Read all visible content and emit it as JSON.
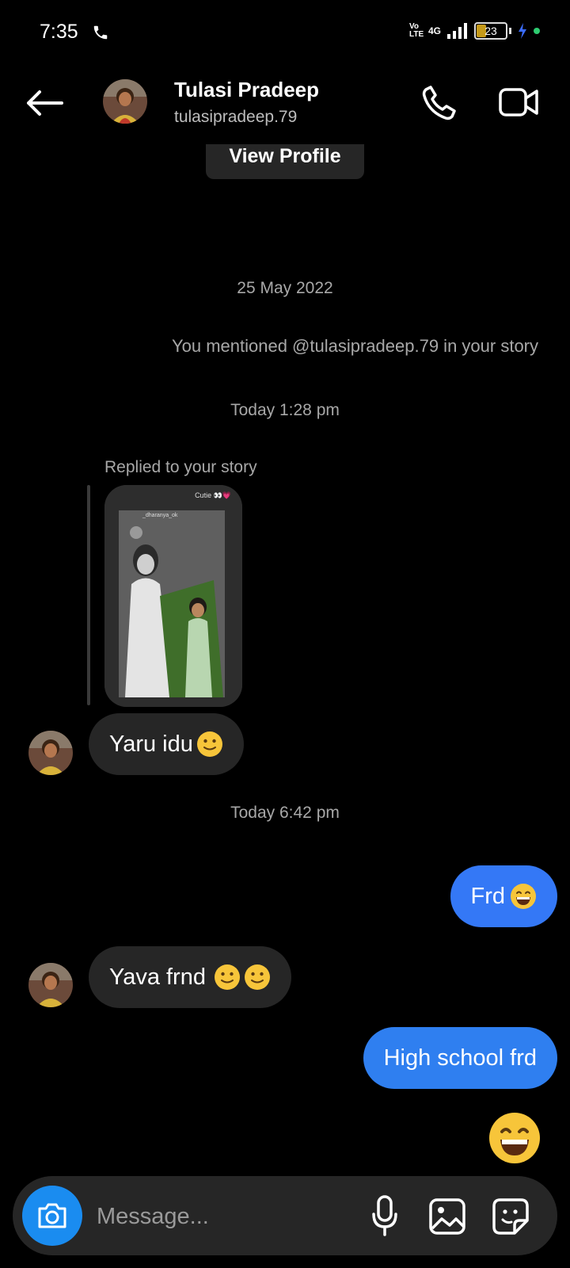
{
  "status_bar": {
    "time": "7:35",
    "volte": "Vo LTE",
    "network": "4G",
    "battery": "23"
  },
  "header": {
    "name": "Tulasi Pradeep",
    "handle": "tulasipradeep.79",
    "view_profile": "View Profile"
  },
  "thread": {
    "date_1": "25 May 2022",
    "mention_note": "You mentioned @tulasipradeep.79 in your story",
    "time_1": "Today 1:28 pm",
    "story_reply_label": "Replied to your story",
    "story_caption": "Cutie 👀💗",
    "story_user": "_dharanya_ok",
    "msg_1": "Yaru idu",
    "time_2": "Today 6:42 pm",
    "msg_2": "Frd",
    "msg_3": "Yava frnd",
    "msg_4": "High school frd"
  },
  "composer": {
    "placeholder": "Message..."
  },
  "colors": {
    "background": "#000000",
    "incoming_bubble": "#262626",
    "outgoing_bubble": "#3478f6",
    "camera_button": "#1a8cf0"
  },
  "icons": [
    "back-arrow-icon",
    "phone-icon",
    "video-camera-icon",
    "camera-icon",
    "microphone-icon",
    "gallery-icon",
    "sticker-icon"
  ]
}
